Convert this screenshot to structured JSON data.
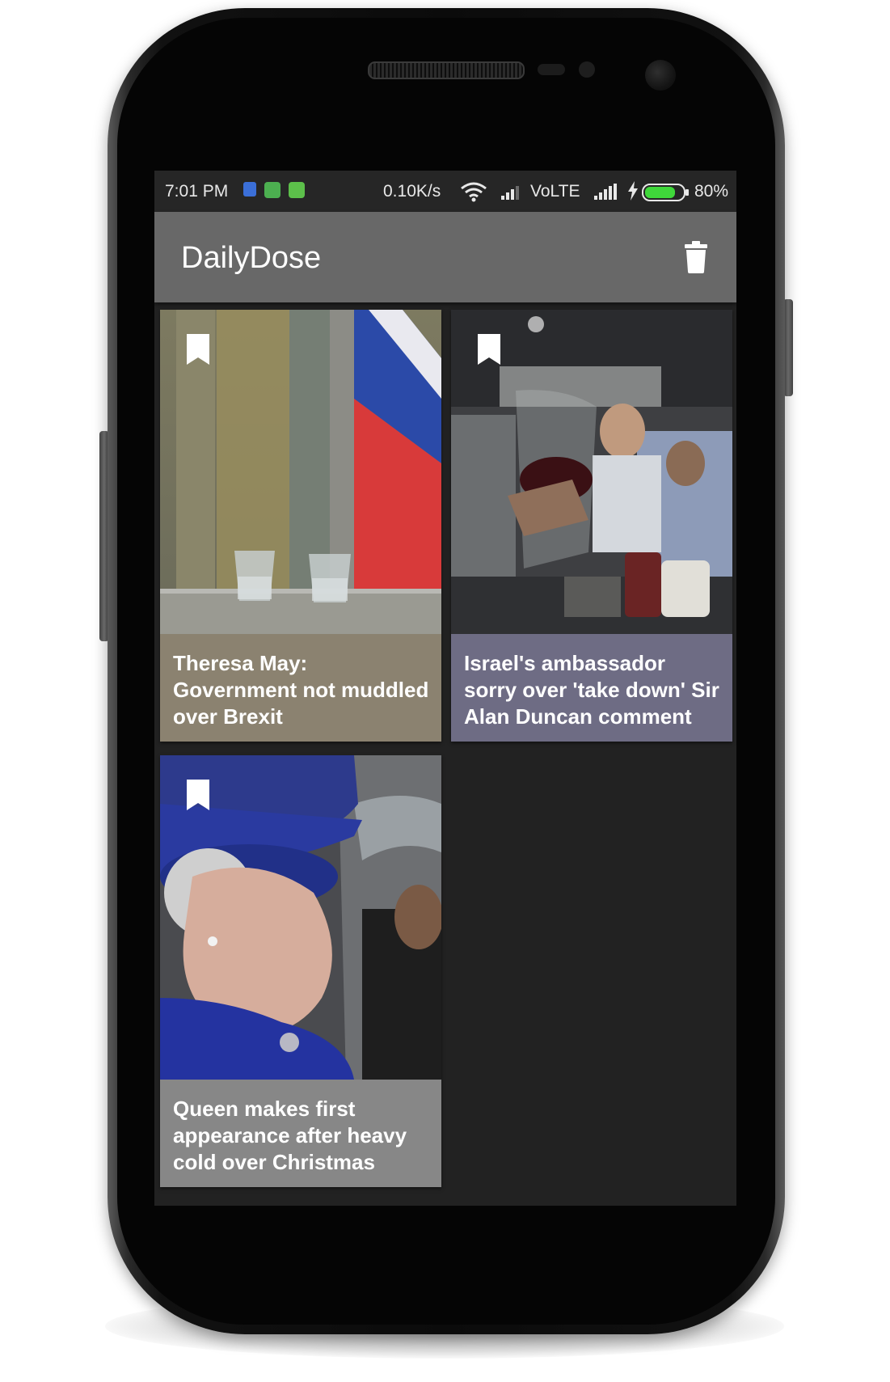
{
  "status_bar": {
    "time": "7:01 PM",
    "speed": "0.10K/s",
    "network": "VoLTE",
    "battery_pct": "80%",
    "battery_level": 0.8
  },
  "app_bar": {
    "title": "DailyDose",
    "action_icon": "trash-icon"
  },
  "articles": [
    {
      "title": "Theresa May: Government not muddled over Brexit",
      "caption_color": "#8b8270",
      "bookmark_icon": "bookmark-icon"
    },
    {
      "title": "Israel's ambassador sorry over 'take down' Sir Alan Duncan comment",
      "caption_color": "#6e6c84",
      "bookmark_icon": "bookmark-icon"
    },
    {
      "title": "Queen makes first appearance after heavy cold over Christmas",
      "caption_color": "#878787",
      "bookmark_icon": "bookmark-icon"
    }
  ]
}
